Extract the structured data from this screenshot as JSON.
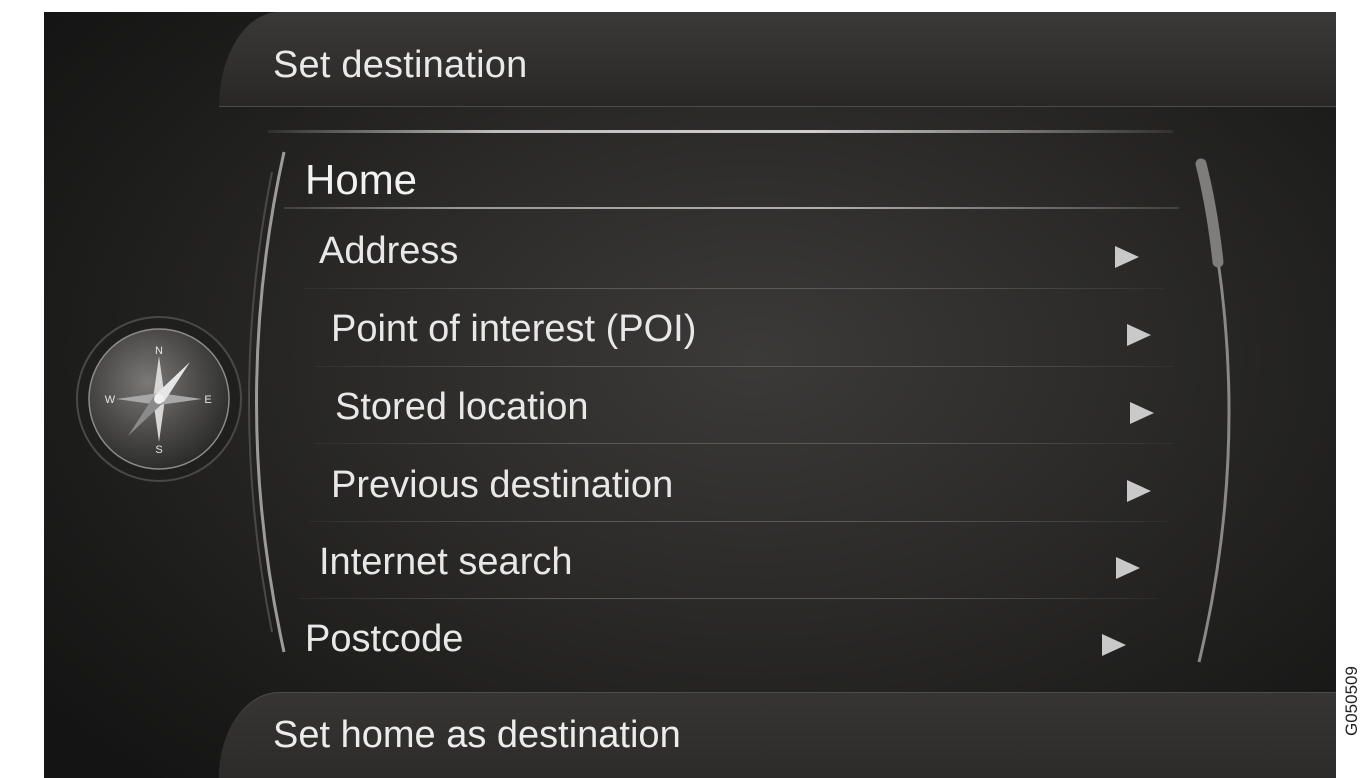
{
  "header": {
    "title": "Set destination"
  },
  "menu": {
    "title": "Home",
    "items": [
      {
        "label": "Address"
      },
      {
        "label": "Point of interest (POI)"
      },
      {
        "label": "Stored location"
      },
      {
        "label": "Previous destination"
      },
      {
        "label": "Internet search"
      },
      {
        "label": "Postcode"
      }
    ]
  },
  "footer": {
    "label": "Set home as destination"
  },
  "compass": {
    "north": "N",
    "south": "S",
    "east": "E",
    "west": "W"
  },
  "side_code": "G050509",
  "colors": {
    "background": "#232221",
    "text": "#e8e8e8",
    "accent": "#c9c9c9"
  },
  "icons": {
    "compass": "compass-icon",
    "submenu": "chevron-right-icon"
  }
}
